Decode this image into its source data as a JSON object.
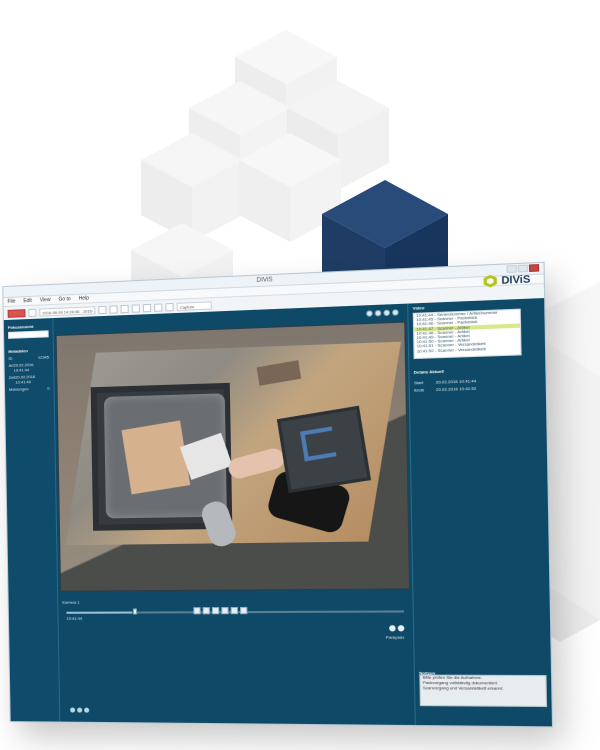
{
  "app": {
    "window_title": "DIViS",
    "brand_text": "DIViS",
    "menu_items": [
      "File",
      "Edit",
      "View",
      "Go to",
      "Help"
    ]
  },
  "toolbar": {
    "search_value": "2016-06-09 14:28:46 - 2016-06-09 14:34:11",
    "capture_value": "Capture",
    "go_label": "Go",
    "stop_label": "Stop"
  },
  "left_panel": {
    "title": "Fokusansicht",
    "meta_title": "Metadaten",
    "rows": [
      {
        "key": "ID",
        "value": "12345"
      },
      {
        "key": "Art",
        "value": "20.02.2016 10:41:44"
      },
      {
        "key": "Zeit",
        "value": "20.02.2016 10:41:48"
      },
      {
        "key": "Meldungen",
        "value": "0"
      }
    ]
  },
  "center": {
    "left_status": "Kamera 1",
    "timeline_time": "10:41:44",
    "scene_label": "Packplatz"
  },
  "right_panel": {
    "events_title": "Video",
    "events": [
      "10:41:44 - Seriennummer / Artikelnummer",
      "10:41:45 - Scanner - Packstück",
      "10:41:46 - Scanner - Packstück",
      "10:41:47 - Scanner - Artikel",
      "10:41:48 - Scanner - Artikel",
      "10:41:49 - Scanner - Artikel",
      "10:41:50 - Scanner - Artikel",
      "10:41:51 - Scanner - Versandetikett",
      "10:41:52 - Scanner - Versandetikett"
    ],
    "details_title": "Details Aktuell",
    "details": [
      {
        "key": "Start",
        "value": "20.02.2016 10:41:44"
      },
      {
        "key": "Ende",
        "value": "20.02.2016 10:41:52"
      }
    ],
    "notes_title": "Notizen",
    "notes": [
      "Bitte prüfen Sie die Aufnahme.",
      "Packvorgang vollständig dokumentiert.",
      "Scanvorgang und Versandetikett erkannt."
    ]
  }
}
